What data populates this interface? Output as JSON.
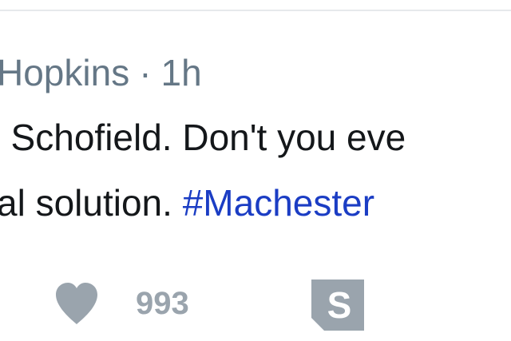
{
  "tweet": {
    "author_partial": "Hopkins",
    "separator": "·",
    "timestamp": "1h",
    "line1": ". Schofield. Don't you eve",
    "line2_text": "al solution. ",
    "hashtag": "#Machester"
  },
  "actions": {
    "like_icon": "heart-icon",
    "like_count": "993",
    "share_icon": "s-share-icon",
    "share_letter": "S"
  },
  "colors": {
    "meta_gray": "#657786",
    "text": "#14171a",
    "hashtag": "#1b3dc4",
    "icon_gray": "#9aa4ad"
  }
}
